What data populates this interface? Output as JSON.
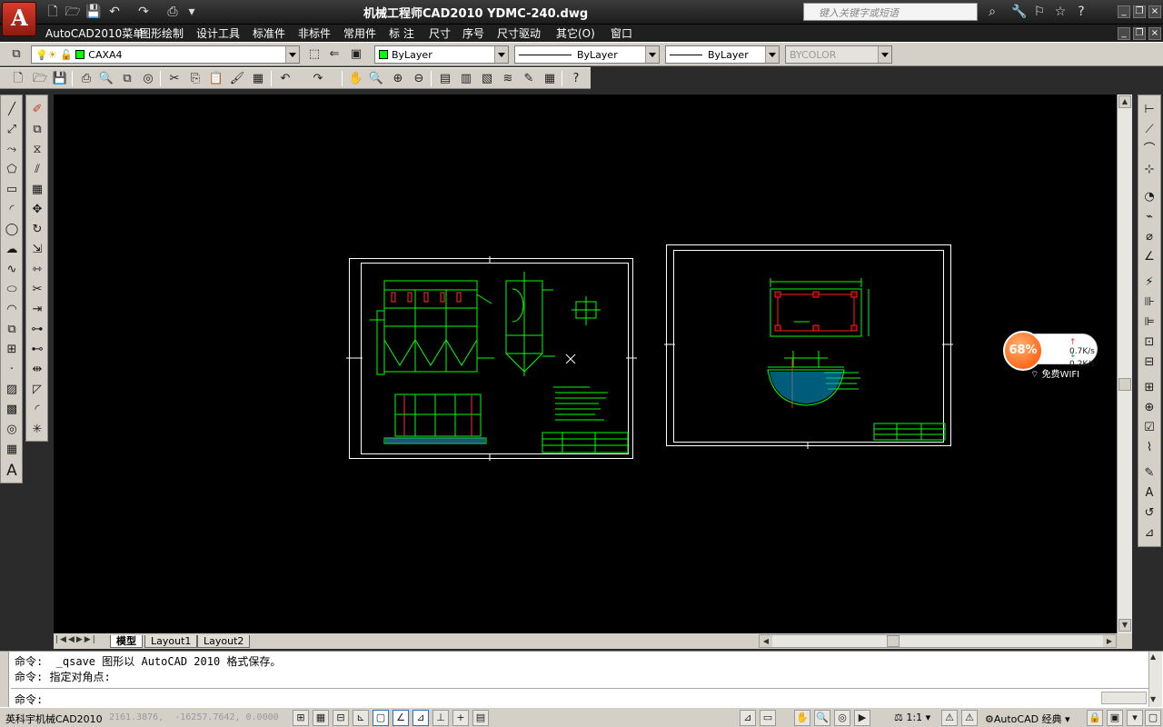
{
  "titlebar": {
    "title": "机械工程师CAD2010   YDMC-240.dwg",
    "search_placeholder": "键入关键字或短语",
    "logo_letter": "A"
  },
  "menu": {
    "items": [
      "AutoCAD2010菜单",
      "图形绘制",
      "设计工具",
      "标准件",
      "非标件",
      "常用件",
      "标 注",
      "尺寸",
      "序号",
      "尺寸驱动",
      "其它(O)",
      "窗口"
    ]
  },
  "layerbar": {
    "layer": "CAXA4",
    "color": "ByLayer",
    "linetype": "ByLayer",
    "lineweight": "ByLayer",
    "plotstyle": "BYCOLOR"
  },
  "tabs": {
    "model": "模型",
    "layout1": "Layout1",
    "layout2": "Layout2"
  },
  "command": {
    "line1": "命令:  _qsave 图形以 AutoCAD 2010 格式保存。",
    "line2": "命令: 指定对角点:",
    "prompt": "命令:"
  },
  "status": {
    "app_name": "英科宇机械CAD2010",
    "coords": "2161.3876,  -16257.7642, 0.0000",
    "scale": "1:1",
    "workspace": "AutoCAD 经典"
  },
  "net_widget": {
    "percent": "68%",
    "upload": "0.7K/s",
    "download": "0.2K/s",
    "wifi": "免费WIFI"
  },
  "colors": {
    "canvas_bg": "#000000",
    "geometry_green": "#00ff00",
    "frame_white": "#ffffff",
    "accent_red": "#ff0000",
    "hatch_cyan": "#00c8ff"
  }
}
